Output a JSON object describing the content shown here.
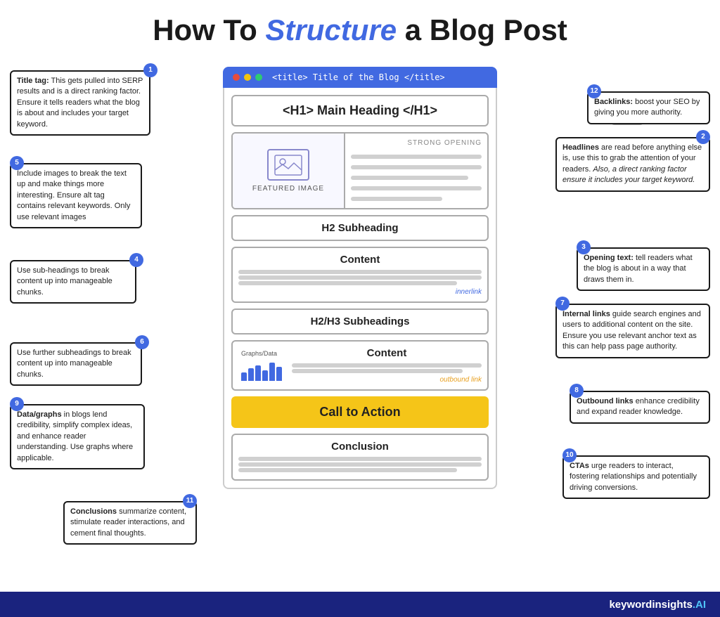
{
  "page": {
    "title": "How To Structure a Blog Post",
    "title_highlight": "Structure",
    "footer": {
      "brand": "keyword",
      "brand_bold": "insights",
      "ai": ".AI"
    }
  },
  "browser": {
    "title": "<title> Title of the Blog </title>"
  },
  "blog": {
    "h1": "<H1> Main Heading </H1>",
    "featured_label": "FEATURED IMAGE",
    "strong_opening": "STRONG OPENING",
    "h2": "H2 Subheading",
    "content1": "Content",
    "innerlink": "innerlink",
    "h2h3": "H2/H3 Subheadings",
    "content2": "Content",
    "outbound_link": "outbound link",
    "graphs_label": "Graphs/Data",
    "cta": "Call to Action",
    "conclusion": "Conclusion"
  },
  "annotations": {
    "ann1": {
      "num": "1",
      "text": "Title tag: This gets pulled into SERP results and is a direct ranking factor. Ensure it tells readers what the blog is about and includes your target keyword."
    },
    "ann2": {
      "num": "2",
      "text": "Headlines are read before anything else is, use this to grab the attention of your readers. Also, a direct ranking factor ensure it includes your target keyword."
    },
    "ann3": {
      "num": "3",
      "text": "Opening text: tell readers what the blog is about in a way that draws them in."
    },
    "ann4": {
      "num": "4",
      "text": "Use sub-headings to break content up into manageable chunks."
    },
    "ann5": {
      "num": "5",
      "text": "Include images to break the text up and make things more interesting. Ensure alt tag contains relevant keywords.  Only use relevant images"
    },
    "ann6": {
      "num": "6",
      "text": "Use further subheadings to break content up into manageable chunks."
    },
    "ann7": {
      "num": "7",
      "text": "Internal links guide search engines and users to additional content on the site. Ensure you use relevant anchor text as this can help pass page authority."
    },
    "ann8": {
      "num": "8",
      "text": "Outbound links enhance credibility and expand reader knowledge."
    },
    "ann9": {
      "num": "9",
      "text": "Data/graphs in blogs lend credibility, simplify complex ideas, and enhance reader understanding. Use graphs where applicable."
    },
    "ann10": {
      "num": "10",
      "text": "CTAs urge readers to interact, fostering  relationships and potentially driving conversions."
    },
    "ann11": {
      "num": "11",
      "text": "Conclusions summarize content, stimulate reader interactions, and cement final thoughts."
    },
    "ann12": {
      "num": "12",
      "text": "Backlinks: boost your SEO by giving you more authority."
    }
  }
}
